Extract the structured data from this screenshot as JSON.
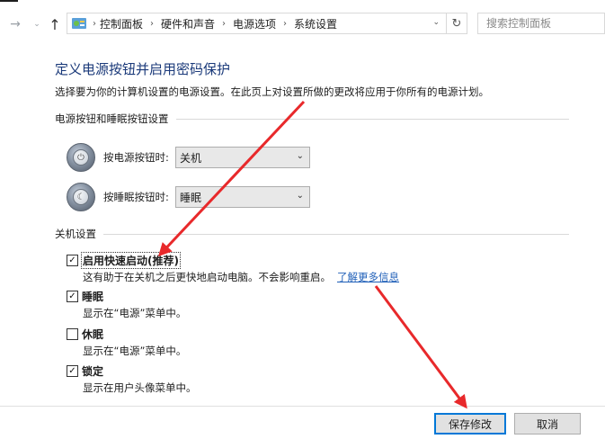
{
  "nav": {
    "back_icon": "arrow-left-icon",
    "forward_icon": "arrow-right-icon",
    "recent_icon": "chevron-down-icon",
    "up_icon": "arrow-up-icon",
    "breadcrumbs": [
      "控制面板",
      "硬件和声音",
      "电源选项",
      "系统设置"
    ],
    "search_placeholder": "搜索控制面板"
  },
  "page": {
    "title": "定义电源按钮并启用密码保护",
    "subtitle": "选择要为你的计算机设置的电源设置。在此页上对设置所做的更改将应用于你所有的电源计划。"
  },
  "buttons_section": {
    "header": "电源按钮和睡眠按钮设置",
    "power": {
      "label": "按电源按钮时:",
      "value": "关机"
    },
    "sleep": {
      "label": "按睡眠按钮时:",
      "value": "睡眠"
    }
  },
  "shutdown_section": {
    "header": "关机设置",
    "items": [
      {
        "label": "启用快速启动(推荐)",
        "checked": true,
        "desc": "这有助于在关机之后更快地启动电脑。不会影响重启。",
        "link": "了解更多信息"
      },
      {
        "label": "睡眠",
        "checked": true,
        "desc": "显示在“电源”菜单中。"
      },
      {
        "label": "休眠",
        "checked": false,
        "desc": "显示在“电源”菜单中。"
      },
      {
        "label": "锁定",
        "checked": true,
        "desc": "显示在用户头像菜单中。"
      }
    ]
  },
  "footer": {
    "save": "保存修改",
    "cancel": "取消"
  },
  "colors": {
    "title": "#1b3a7a",
    "link": "#1f5fb8",
    "arrow": "#e8292b",
    "primary_border": "#0078d7"
  }
}
